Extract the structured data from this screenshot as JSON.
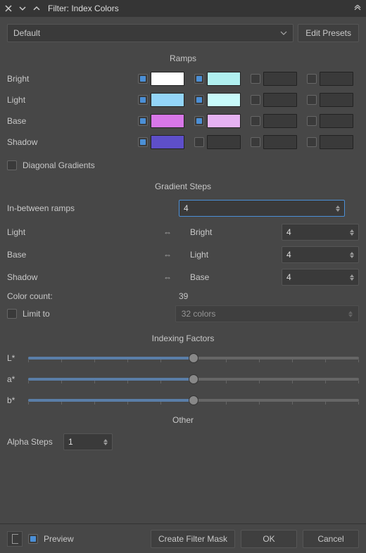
{
  "window": {
    "title": "Filter: Index Colors"
  },
  "preset": {
    "selected": "Default",
    "edit_label": "Edit Presets"
  },
  "sections": {
    "ramps": "Ramps",
    "gradient_steps": "Gradient Steps",
    "indexing_factors": "Indexing Factors",
    "other": "Other"
  },
  "ramps": [
    {
      "label": "Bright",
      "cols": [
        {
          "checked": true,
          "color": "#fefefe"
        },
        {
          "checked": true,
          "color": "#b0f0f0"
        },
        {
          "checked": false,
          "color": "#3a3a3a"
        },
        {
          "checked": false,
          "color": "#3a3a3a"
        }
      ]
    },
    {
      "label": "Light",
      "cols": [
        {
          "checked": true,
          "color": "#93d5f8"
        },
        {
          "checked": true,
          "color": "#c8fbfb"
        },
        {
          "checked": false,
          "color": "#3a3a3a"
        },
        {
          "checked": false,
          "color": "#3a3a3a"
        }
      ]
    },
    {
      "label": "Base",
      "cols": [
        {
          "checked": true,
          "color": "#d877e8"
        },
        {
          "checked": true,
          "color": "#e6b2f2"
        },
        {
          "checked": false,
          "color": "#3a3a3a"
        },
        {
          "checked": false,
          "color": "#3a3a3a"
        }
      ]
    },
    {
      "label": "Shadow",
      "cols": [
        {
          "checked": true,
          "color": "#5e4fc9"
        },
        {
          "checked": false,
          "color": "#3a3a3a"
        },
        {
          "checked": false,
          "color": "#3a3a3a"
        },
        {
          "checked": false,
          "color": "#3a3a3a"
        }
      ]
    }
  ],
  "diagonal": {
    "label": "Diagonal Gradients",
    "checked": false
  },
  "steps": {
    "in_between_label": "In-between ramps",
    "in_between_value": "4",
    "left": [
      {
        "label": "Light"
      },
      {
        "label": "Base"
      },
      {
        "label": "Shadow"
      }
    ],
    "right": [
      {
        "label": "Bright",
        "value": "4"
      },
      {
        "label": "Light",
        "value": "4"
      },
      {
        "label": "Base",
        "value": "4"
      }
    ]
  },
  "color_count": {
    "label": "Color count:",
    "value": "39"
  },
  "limit": {
    "label": "Limit to",
    "checked": false,
    "selected": "32 colors"
  },
  "factors": [
    {
      "label": "L*",
      "pct": 50
    },
    {
      "label": "a*",
      "pct": 50
    },
    {
      "label": "b*",
      "pct": 50
    }
  ],
  "alpha": {
    "label": "Alpha Steps",
    "value": "1"
  },
  "footer": {
    "preview_label": "Preview",
    "preview_checked": true,
    "create_mask": "Create Filter Mask",
    "ok": "OK",
    "cancel": "Cancel"
  }
}
